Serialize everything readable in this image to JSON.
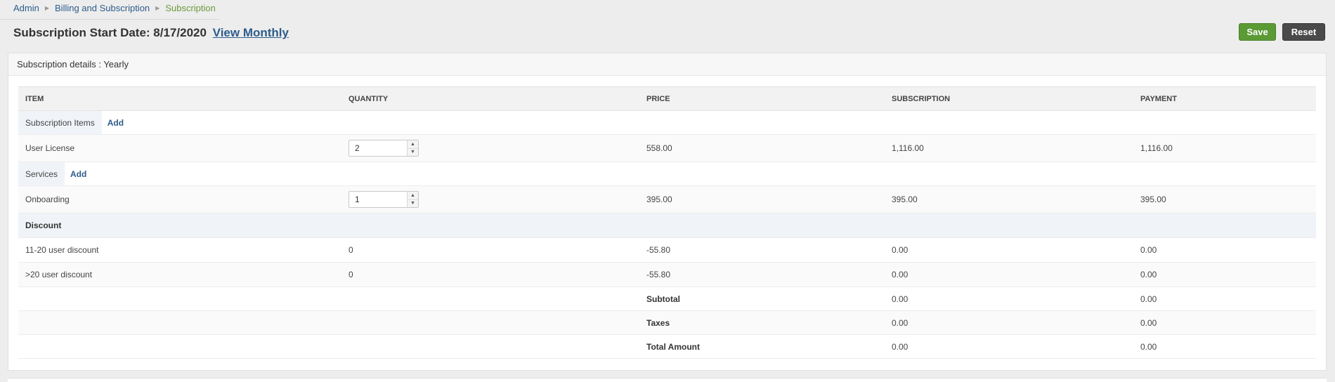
{
  "breadcrumb": {
    "items": [
      "Admin",
      "Billing and Subscription"
    ],
    "current": "Subscription"
  },
  "header": {
    "title": "Subscription Start Date: 8/17/2020",
    "view_link": "View Monthly",
    "save_label": "Save",
    "reset_label": "Reset"
  },
  "panel": {
    "title": "Subscription details : Yearly"
  },
  "table": {
    "columns": [
      "ITEM",
      "QUANTITY",
      "PRICE",
      "SUBSCRIPTION",
      "PAYMENT"
    ],
    "groups": {
      "subscription_items": {
        "label": "Subscription Items",
        "add": "Add"
      },
      "services": {
        "label": "Services",
        "add": "Add"
      },
      "discount": {
        "label": "Discount"
      }
    },
    "user_license": {
      "item": "User License",
      "quantity": "2",
      "price": "558.00",
      "subscription": "1,116.00",
      "payment": "1,116.00"
    },
    "onboarding": {
      "item": "Onboarding",
      "quantity": "1",
      "price": "395.00",
      "subscription": "395.00",
      "payment": "395.00"
    },
    "discount_rows": [
      {
        "item": "11-20 user discount",
        "quantity": "0",
        "price": "-55.80",
        "subscription": "0.00",
        "payment": "0.00"
      },
      {
        "item": ">20 user discount",
        "quantity": "0",
        "price": "-55.80",
        "subscription": "0.00",
        "payment": "0.00"
      }
    ],
    "summary": [
      {
        "label": "Subtotal",
        "subscription": "0.00",
        "payment": "0.00"
      },
      {
        "label": "Taxes",
        "subscription": "0.00",
        "payment": "0.00"
      },
      {
        "label": "Total Amount",
        "subscription": "0.00",
        "payment": "0.00"
      }
    ]
  },
  "icons": {
    "breadcrumb_separator": "chevron-right-icon",
    "stepper_up": "caret-up-icon",
    "stepper_down": "caret-down-icon"
  },
  "colors": {
    "link": "#2d5c8a",
    "current_breadcrumb": "#6a9a3c",
    "save_button": "#5b9a35",
    "reset_button": "#4a4a4a"
  }
}
